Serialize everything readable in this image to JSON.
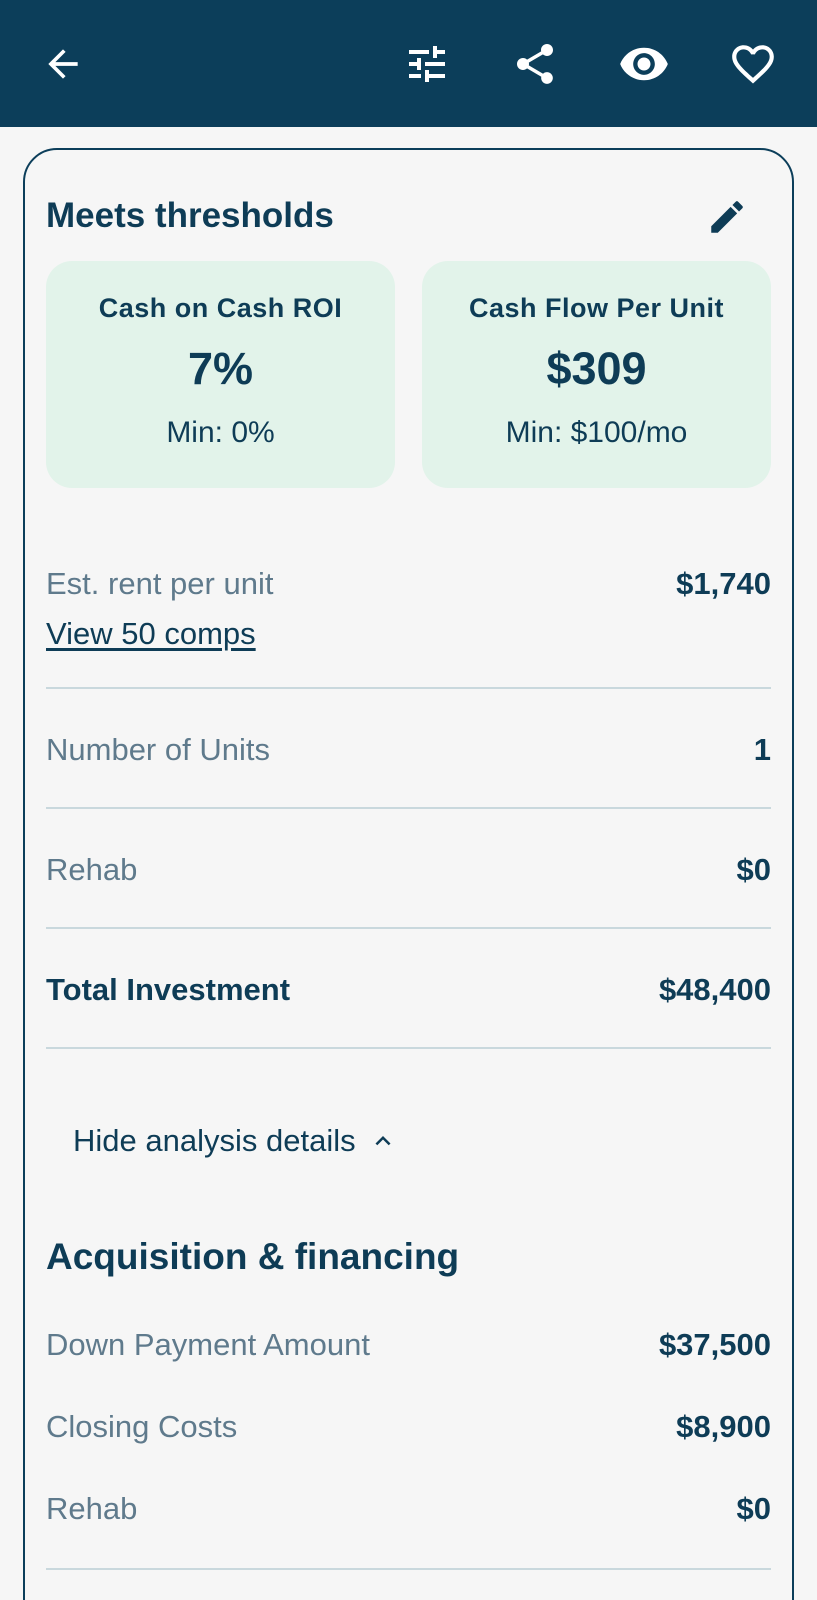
{
  "header": {
    "back_icon": "arrow-left-icon",
    "filter_icon": "sliders-icon",
    "share_icon": "share-icon",
    "view_icon": "eye-icon",
    "favorite_icon": "heart-outline-icon",
    "background": "#0c3e5a"
  },
  "card": {
    "title": "Meets thresholds",
    "edit_icon": "pencil-icon",
    "metrics": [
      {
        "label": "Cash on Cash ROI",
        "value": "7%",
        "min": "Min: 0%"
      },
      {
        "label": "Cash Flow Per Unit",
        "value": "$309",
        "min": "Min: $100/mo"
      }
    ],
    "metric_bg": "#e2f3ea",
    "rows": {
      "rent_label": "Est. rent per unit",
      "rent_value": "$1,740",
      "comps_link": "View 50 comps",
      "units_label": "Number of Units",
      "units_value": "1",
      "rehab_label": "Rehab",
      "rehab_value": "$0",
      "total_label": "Total Investment",
      "total_value": "$48,400"
    },
    "toggle_label": "Hide analysis details",
    "toggle_icon": "chevron-up-icon",
    "acquisition": {
      "title": "Acquisition & financing",
      "items": [
        {
          "label": "Down Payment Amount",
          "value": "$37,500"
        },
        {
          "label": "Closing Costs",
          "value": "$8,900"
        },
        {
          "label": "Rehab",
          "value": "$0"
        }
      ]
    }
  }
}
